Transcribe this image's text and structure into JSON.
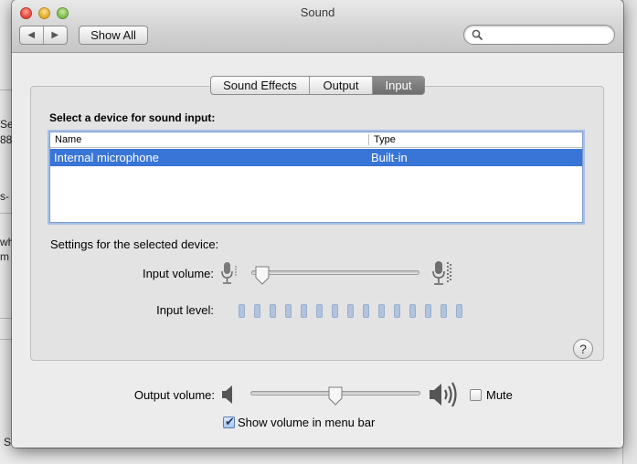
{
  "window": {
    "title": "Sound",
    "show_all_label": "Show All",
    "search_placeholder": ""
  },
  "tabs": [
    {
      "label": "Sound Effects"
    },
    {
      "label": "Output"
    },
    {
      "label": "Input",
      "selected": true
    }
  ],
  "input_pane": {
    "select_device_label": "Select a device for sound input:",
    "table": {
      "columns": [
        "Name",
        "Type"
      ],
      "rows": [
        {
          "name": "Internal microphone",
          "type": "Built-in",
          "selected": true
        }
      ]
    },
    "settings_label": "Settings for the selected device:",
    "input_volume_label": "Input volume:",
    "input_volume_level": 0.03,
    "input_level_label": "Input level:",
    "input_level_cells": 15
  },
  "output": {
    "output_volume_label": "Output volume:",
    "output_volume_level": 0.5,
    "mute_label": "Mute",
    "mute_checked": false,
    "show_volume_label": "Show volume in menu bar",
    "show_volume_checked": true
  },
  "background_window": {
    "fragments": [
      "Se",
      "88",
      "s-",
      "wh",
      "m",
      "S"
    ]
  },
  "colors": {
    "selection": "#3875d7",
    "level_meter": "#b2c3dd",
    "close": "#e0443a",
    "minimize": "#e0a92a",
    "zoom": "#7cb94a"
  }
}
